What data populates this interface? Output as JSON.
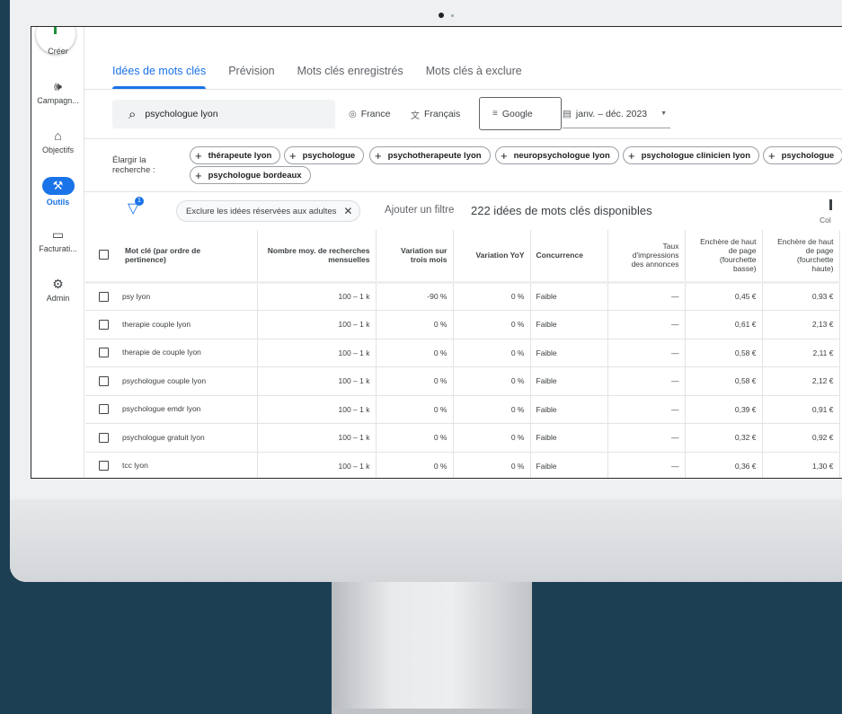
{
  "rail": {
    "create_label": "Créer",
    "items": [
      {
        "label": "Campagn...",
        "icon": "megaphone-icon"
      },
      {
        "label": "Objectifs",
        "icon": "trophy-icon"
      },
      {
        "label": "Outils",
        "icon": "tools-icon"
      },
      {
        "label": "Facturati...",
        "icon": "credit-card-icon"
      },
      {
        "label": "Admin",
        "icon": "gear-icon"
      }
    ]
  },
  "tabs": [
    "Idées de mots clés",
    "Prévision",
    "Mots clés enregistrés",
    "Mots clés à exclure"
  ],
  "search": {
    "value": "psychologue lyon"
  },
  "filters": {
    "location": "France",
    "language": "Français",
    "network": "Google",
    "date_range": "janv. – déc. 2023"
  },
  "broaden": {
    "label_line1": "Élargir la",
    "label_line2": "recherche :",
    "chips": [
      "thérapeute lyon",
      "psychologue",
      "psychotherapeute lyon",
      "neuropsychologue lyon",
      "psychologue clinicien lyon",
      "psychologue",
      "psychologue bordeaux"
    ]
  },
  "toolbar": {
    "filter_badge": "1",
    "exclude_chip": "Exclure les idées réservées aux adultes",
    "add_filter": "Ajouter un filtre",
    "available": "222 idées de mots clés disponibles",
    "columns": "Col"
  },
  "table": {
    "headers": {
      "keyword_1": "Mot clé (par ordre de",
      "keyword_2": "pertinence)",
      "avg_1": "Nombre moy. de recherches",
      "avg_2": "mensuelles",
      "three_1": "Variation sur",
      "three_2": "trois mois",
      "yoy": "Variation YoY",
      "comp": "Concurrence",
      "impr_1": "Taux",
      "impr_2": "d'impressions",
      "impr_3": "des annonces",
      "low_1": "Enchère de haut",
      "low_2": "de page",
      "low_3": "(fourchette",
      "low_4": "basse)",
      "high_1": "Enchère de haut",
      "high_2": "de page",
      "high_3": "(fourchette",
      "high_4": "haute)"
    },
    "rows": [
      {
        "kw": "psy lyon",
        "avg": "100 – 1 k",
        "three": "-90 %",
        "yoy": "0 %",
        "comp": "Faible",
        "impr": "—",
        "low": "0,45 €",
        "high": "0,93 €"
      },
      {
        "kw": "therapie couple lyon",
        "avg": "100 – 1 k",
        "three": "0 %",
        "yoy": "0 %",
        "comp": "Faible",
        "impr": "—",
        "low": "0,61 €",
        "high": "2,13 €"
      },
      {
        "kw": "therapie de couple lyon",
        "avg": "100 – 1 k",
        "three": "0 %",
        "yoy": "0 %",
        "comp": "Faible",
        "impr": "—",
        "low": "0,58 €",
        "high": "2,11 €"
      },
      {
        "kw": "psychologue couple lyon",
        "avg": "100 – 1 k",
        "three": "0 %",
        "yoy": "0 %",
        "comp": "Faible",
        "impr": "—",
        "low": "0,58 €",
        "high": "2,12 €"
      },
      {
        "kw": "psychologue emdr lyon",
        "avg": "100 – 1 k",
        "three": "0 %",
        "yoy": "0 %",
        "comp": "Faible",
        "impr": "—",
        "low": "0,39 €",
        "high": "0,91 €"
      },
      {
        "kw": "psychologue gratuit lyon",
        "avg": "100 – 1 k",
        "three": "0 %",
        "yoy": "0 %",
        "comp": "Faible",
        "impr": "—",
        "low": "0,32 €",
        "high": "0,92 €"
      },
      {
        "kw": "tcc lyon",
        "avg": "100 – 1 k",
        "three": "0 %",
        "yoy": "0 %",
        "comp": "Faible",
        "impr": "—",
        "low": "0,36 €",
        "high": "1,30 €"
      }
    ]
  }
}
